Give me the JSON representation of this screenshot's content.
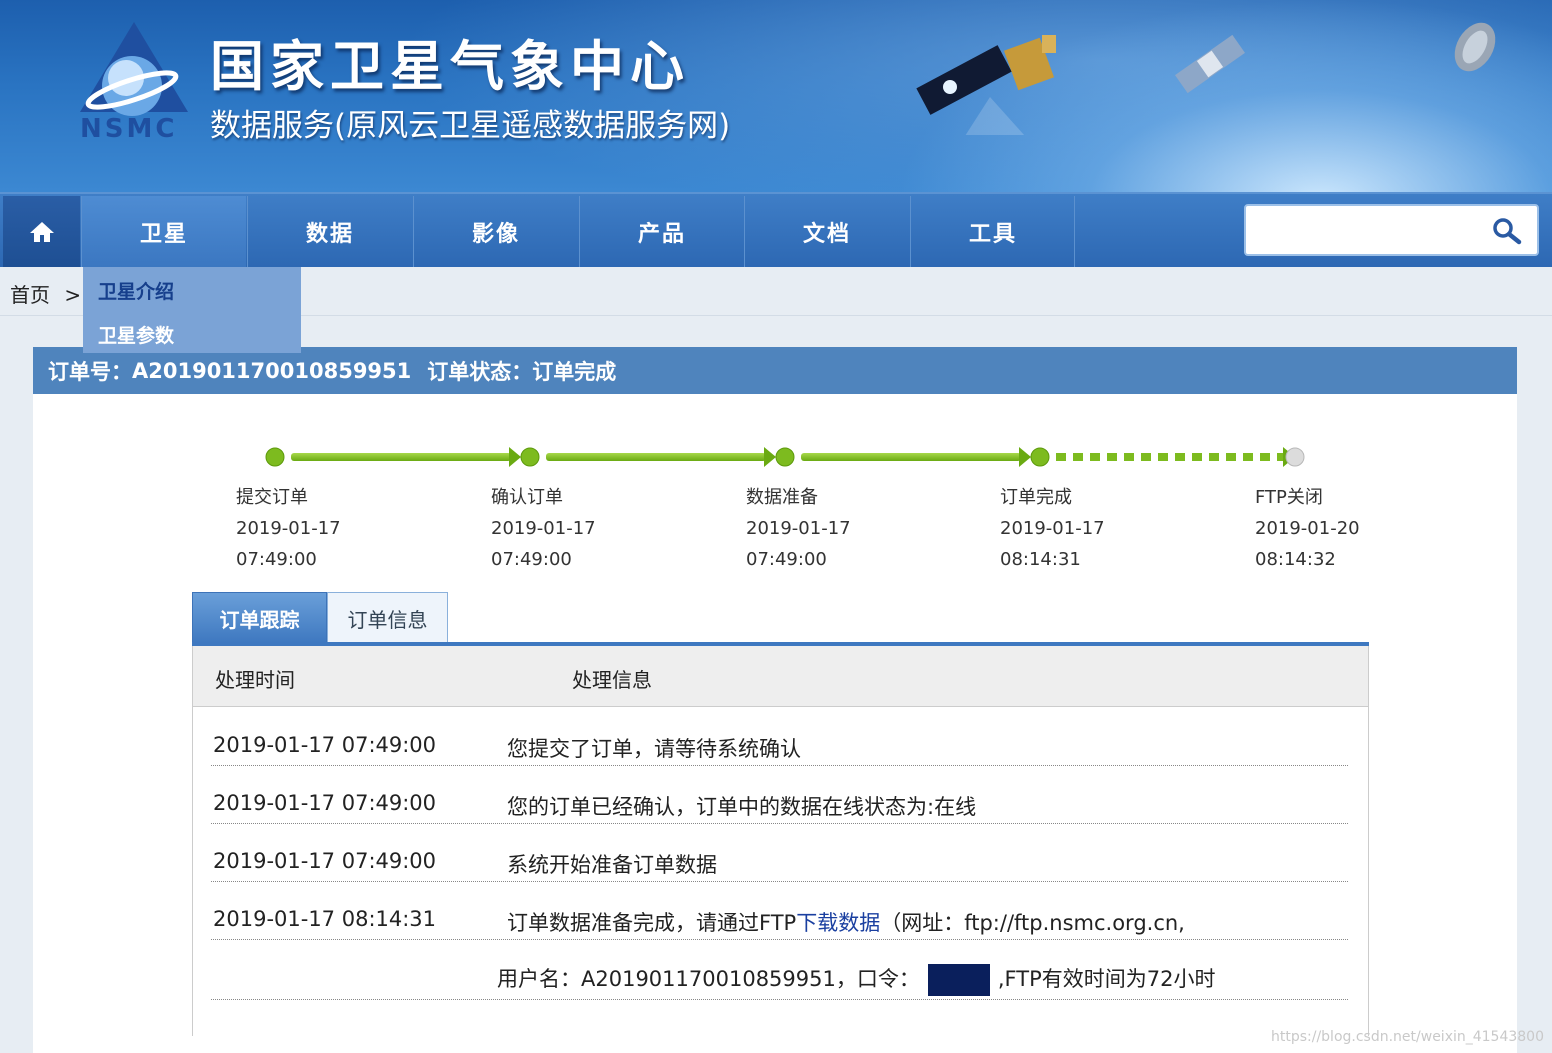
{
  "site": {
    "title": "国家卫星气象中心",
    "subtitle": "数据服务(原风云卫星遥感数据服务网)",
    "logo_text": "NSMC"
  },
  "nav": {
    "items": [
      "卫星",
      "数据",
      "影像",
      "产品",
      "文档",
      "工具"
    ],
    "active_index": 0,
    "search_placeholder": ""
  },
  "breadcrumb": {
    "home": "首页",
    "separator": ">"
  },
  "dropdown": {
    "items": [
      "卫星介绍",
      "卫星参数"
    ]
  },
  "order": {
    "number_label": "订单号：",
    "number": "A201901170010859951",
    "status_label": "订单状态：",
    "status": "订单完成"
  },
  "steps": [
    {
      "name": "提交订单",
      "date": "2019-01-17",
      "time": "07:49:00",
      "done": true
    },
    {
      "name": "确认订单",
      "date": "2019-01-17",
      "time": "07:49:00",
      "done": true
    },
    {
      "name": "数据准备",
      "date": "2019-01-17",
      "time": "07:49:00",
      "done": true
    },
    {
      "name": "订单完成",
      "date": "2019-01-17",
      "time": "08:14:31",
      "done": true
    },
    {
      "name": "FTP关闭",
      "date": "2019-01-20",
      "time": "08:14:32",
      "done": false
    }
  ],
  "tabs": {
    "active": "订单跟踪",
    "inactive": "订单信息"
  },
  "table": {
    "headers": [
      "处理时间",
      "处理信息"
    ],
    "rows": [
      {
        "time": "2019-01-17 07:49:00",
        "message": "您提交了订单，请等待系统确认"
      },
      {
        "time": "2019-01-17 07:49:00",
        "message": "您的订单已经确认，订单中的数据在线状态为:在线"
      },
      {
        "time": "2019-01-17 07:49:00",
        "message": "系统开始准备订单数据"
      },
      {
        "time": "2019-01-17 08:14:31",
        "message_prefix": "订单数据准备完成，请通过FTP",
        "message_link": "下载数据",
        "message_suffix": "（网址：ftp://ftp.nsmc.org.cn,"
      },
      {
        "time": "",
        "message_prefix": "用户名：A201901170010859951，口令：",
        "message_suffix": ",FTP有效时间为72小时"
      }
    ]
  },
  "watermark": "https://blog.csdn.net/weixin_41543800",
  "colors": {
    "nav": "#2d68b3",
    "header_bar": "#4f84bd",
    "step_green": "#7dbb1f",
    "step_gray": "#d8d8d8",
    "redact": "#0a1f5c"
  }
}
